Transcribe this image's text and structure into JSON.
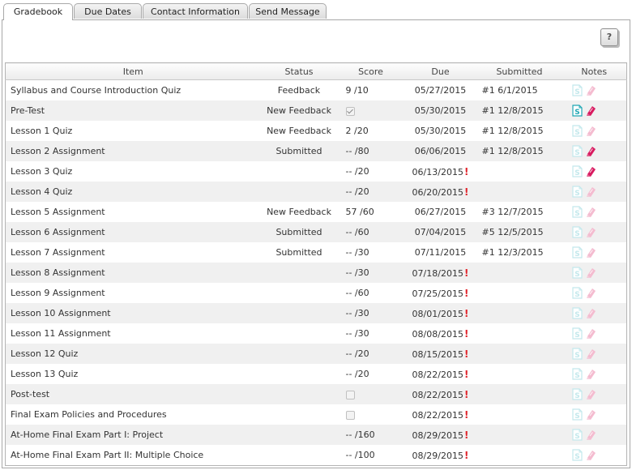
{
  "tabs": [
    "Gradebook",
    "Due Dates",
    "Contact Information",
    "Send Message"
  ],
  "help_label": "?",
  "columns": [
    "Item",
    "Status",
    "Score",
    "Due",
    "Submitted",
    "Notes"
  ],
  "colors": {
    "alert": "#e0242b",
    "s_icon": "#1fa6b3",
    "note_icon": "#d81b60"
  },
  "rows": [
    {
      "item": "Syllabus and Course Introduction Quiz",
      "status": "Feedback",
      "score": "9 /10",
      "checkbox": null,
      "due": "05/27/2015",
      "late": false,
      "submitted": "#1 6/1/2015",
      "s_active": false,
      "note_active": false
    },
    {
      "item": "Pre-Test",
      "status": "New Feedback",
      "score": "",
      "checkbox": "checked",
      "due": "05/30/2015",
      "late": false,
      "submitted": "#1 12/8/2015",
      "s_active": true,
      "note_active": true
    },
    {
      "item": "Lesson 1 Quiz",
      "status": "New Feedback",
      "score": "2 /20",
      "checkbox": null,
      "due": "05/30/2015",
      "late": false,
      "submitted": "#1 12/8/2015",
      "s_active": false,
      "note_active": false
    },
    {
      "item": "Lesson 2 Assignment",
      "status": "Submitted",
      "score": "-- /80",
      "checkbox": null,
      "due": "06/06/2015",
      "late": false,
      "submitted": "#1 12/8/2015",
      "s_active": false,
      "note_active": true
    },
    {
      "item": "Lesson 3 Quiz",
      "status": "",
      "score": "-- /20",
      "checkbox": null,
      "due": "06/13/2015",
      "late": true,
      "submitted": "",
      "s_active": false,
      "note_active": true
    },
    {
      "item": "Lesson 4 Quiz",
      "status": "",
      "score": "-- /20",
      "checkbox": null,
      "due": "06/20/2015",
      "late": true,
      "submitted": "",
      "s_active": false,
      "note_active": false
    },
    {
      "item": "Lesson 5 Assignment",
      "status": "New Feedback",
      "score": "57 /60",
      "checkbox": null,
      "due": "06/27/2015",
      "late": false,
      "submitted": "#3 12/7/2015",
      "s_active": false,
      "note_active": false
    },
    {
      "item": "Lesson 6 Assignment",
      "status": "Submitted",
      "score": "-- /60",
      "checkbox": null,
      "due": "07/04/2015",
      "late": false,
      "submitted": "#5 12/5/2015",
      "s_active": false,
      "note_active": false
    },
    {
      "item": "Lesson 7 Assignment",
      "status": "Submitted",
      "score": "-- /30",
      "checkbox": null,
      "due": "07/11/2015",
      "late": false,
      "submitted": "#1 12/3/2015",
      "s_active": false,
      "note_active": false
    },
    {
      "item": "Lesson 8 Assignment",
      "status": "",
      "score": "-- /30",
      "checkbox": null,
      "due": "07/18/2015",
      "late": true,
      "submitted": "",
      "s_active": false,
      "note_active": false
    },
    {
      "item": "Lesson 9 Assignment",
      "status": "",
      "score": "-- /60",
      "checkbox": null,
      "due": "07/25/2015",
      "late": true,
      "submitted": "",
      "s_active": false,
      "note_active": false
    },
    {
      "item": "Lesson 10 Assignment",
      "status": "",
      "score": "-- /30",
      "checkbox": null,
      "due": "08/01/2015",
      "late": true,
      "submitted": "",
      "s_active": false,
      "note_active": false
    },
    {
      "item": "Lesson 11 Assignment",
      "status": "",
      "score": "-- /30",
      "checkbox": null,
      "due": "08/08/2015",
      "late": true,
      "submitted": "",
      "s_active": false,
      "note_active": false
    },
    {
      "item": "Lesson 12 Quiz",
      "status": "",
      "score": "-- /20",
      "checkbox": null,
      "due": "08/15/2015",
      "late": true,
      "submitted": "",
      "s_active": false,
      "note_active": false
    },
    {
      "item": "Lesson 13 Quiz",
      "status": "",
      "score": "-- /20",
      "checkbox": null,
      "due": "08/22/2015",
      "late": true,
      "submitted": "",
      "s_active": false,
      "note_active": false
    },
    {
      "item": "Post-test",
      "status": "",
      "score": "",
      "checkbox": "unchecked",
      "due": "08/22/2015",
      "late": true,
      "submitted": "",
      "s_active": false,
      "note_active": false
    },
    {
      "item": "Final Exam Policies and Procedures",
      "status": "",
      "score": "",
      "checkbox": "unchecked",
      "due": "08/22/2015",
      "late": true,
      "submitted": "",
      "s_active": false,
      "note_active": false
    },
    {
      "item": "At-Home Final Exam Part I: Project",
      "status": "",
      "score": "-- /160",
      "checkbox": null,
      "due": "08/29/2015",
      "late": true,
      "submitted": "",
      "s_active": false,
      "note_active": false
    },
    {
      "item": "At-Home Final Exam Part II: Multiple Choice",
      "status": "",
      "score": "-- /100",
      "checkbox": null,
      "due": "08/29/2015",
      "late": true,
      "submitted": "",
      "s_active": false,
      "note_active": false
    }
  ]
}
